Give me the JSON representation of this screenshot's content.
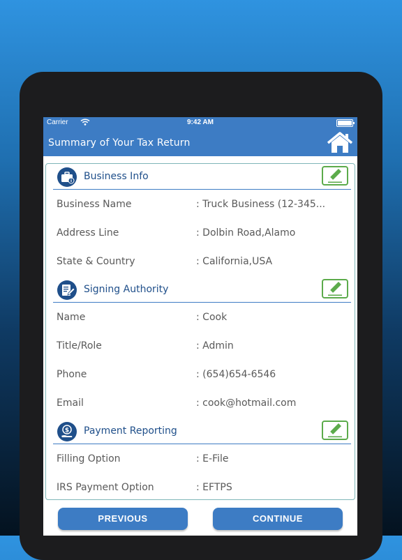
{
  "status_bar": {
    "carrier": "Carrier",
    "time": "9:42 AM"
  },
  "header": {
    "title": "Summary of Your Tax Return",
    "home_icon": "home-icon"
  },
  "sections": [
    {
      "title": "Business Info",
      "icon": "briefcase-info-icon",
      "rows": [
        {
          "label": "Business Name",
          "value": ": Truck Business (12-345..."
        },
        {
          "label": "Address Line",
          "value": ": Dolbin Road,Alamo"
        },
        {
          "label": "State & Country",
          "value": ": California,USA"
        }
      ]
    },
    {
      "title": "Signing Authority",
      "icon": "signing-document-icon",
      "rows": [
        {
          "label": "Name",
          "value": ": Cook"
        },
        {
          "label": "Title/Role",
          "value": ": Admin"
        },
        {
          "label": "Phone",
          "value": ": (654)654-6546"
        },
        {
          "label": "Email",
          "value": ": cook@hotmail.com"
        }
      ]
    },
    {
      "title": "Payment Reporting",
      "icon": "dollar-hand-icon",
      "rows": [
        {
          "label": "Filling Option",
          "value": ": E-File"
        },
        {
          "label": "IRS Payment Option",
          "value": ": EFTPS"
        }
      ]
    }
  ],
  "buttons": {
    "previous": "PREVIOUS",
    "continue": "CONTINUE"
  },
  "colors": {
    "accent": "#3d7cc4",
    "edit_green": "#5cab4b",
    "text_dark_blue": "#1f4f8a",
    "text_gray": "#595959"
  }
}
